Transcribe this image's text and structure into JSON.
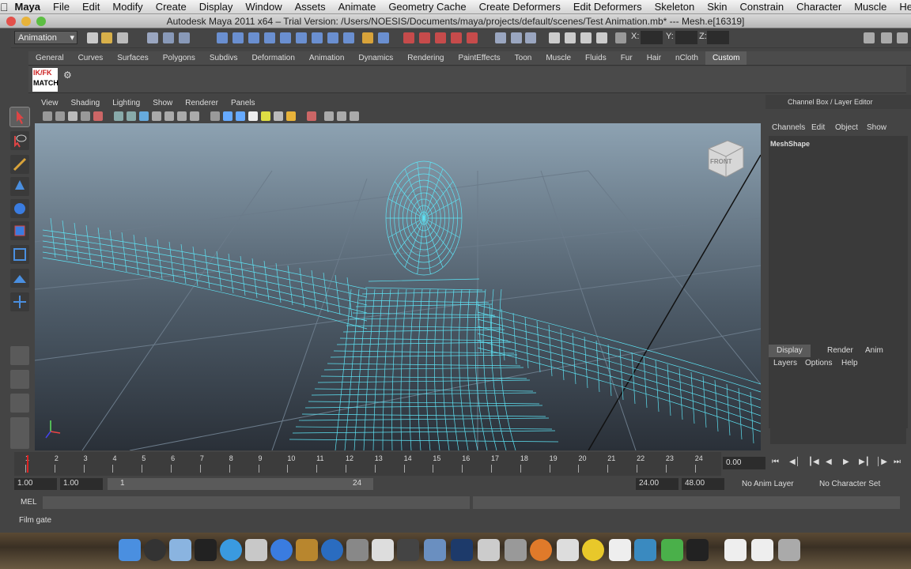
{
  "mac_menu": {
    "app": "Maya",
    "items": [
      "File",
      "Edit",
      "Modify",
      "Create",
      "Display",
      "Window",
      "Assets",
      "Animate",
      "Geometry Cache",
      "Create Deformers",
      "Edit Deformers",
      "Skeleton",
      "Skin",
      "Constrain",
      "Character",
      "Muscle",
      "Help"
    ]
  },
  "window_title": "Autodesk Maya 2011 x64 – Trial Version: /Users/NOESIS/Documents/maya/projects/default/scenes/Test Animation.mb*   ---   Mesh.e[16319]",
  "status_line": {
    "menu_set": "Animation",
    "x_label": "X:",
    "y_label": "Y:",
    "z_label": "Z:"
  },
  "shelf_tabs": [
    "General",
    "Curves",
    "Surfaces",
    "Polygons",
    "Subdivs",
    "Deformation",
    "Animation",
    "Dynamics",
    "Rendering",
    "PaintEffects",
    "Toon",
    "Muscle",
    "Fluids",
    "Fur",
    "Hair",
    "nCloth",
    "Custom"
  ],
  "shelf_active": "Custom",
  "shelf_button": {
    "line1": "IK/FK",
    "line2": "MATCH"
  },
  "panel_menu": [
    "View",
    "Shading",
    "Lighting",
    "Show",
    "Renderer",
    "Panels"
  ],
  "viewcube_label": "FRONT",
  "channel_box": {
    "header": "Channel Box / Layer Editor",
    "menu": [
      "Channels",
      "Edit",
      "Object",
      "Show"
    ],
    "object": "MeshShape",
    "layer_tabs": [
      "Display",
      "Render",
      "Anim"
    ],
    "layer_menu": [
      "Layers",
      "Options",
      "Help"
    ]
  },
  "timeline": {
    "ticks": [
      "1",
      "2",
      "3",
      "4",
      "5",
      "6",
      "7",
      "8",
      "9",
      "10",
      "11",
      "12",
      "13",
      "14",
      "15",
      "16",
      "17",
      "18",
      "19",
      "20",
      "21",
      "22",
      "23",
      "24"
    ],
    "current_frame": "0.00"
  },
  "range": {
    "start": "1.00",
    "anim_start": "1.00",
    "slider_start": "1",
    "slider_end": "24",
    "anim_end": "24.00",
    "end": "48.00",
    "anim_layer": "No Anim Layer",
    "character_set": "No Character Set"
  },
  "command_line": {
    "label": "MEL"
  },
  "help_line": "Film gate",
  "colors": {
    "wire": "#5ee4f5",
    "ui_bg": "#444444",
    "active_tab": "#5c5c5c"
  }
}
